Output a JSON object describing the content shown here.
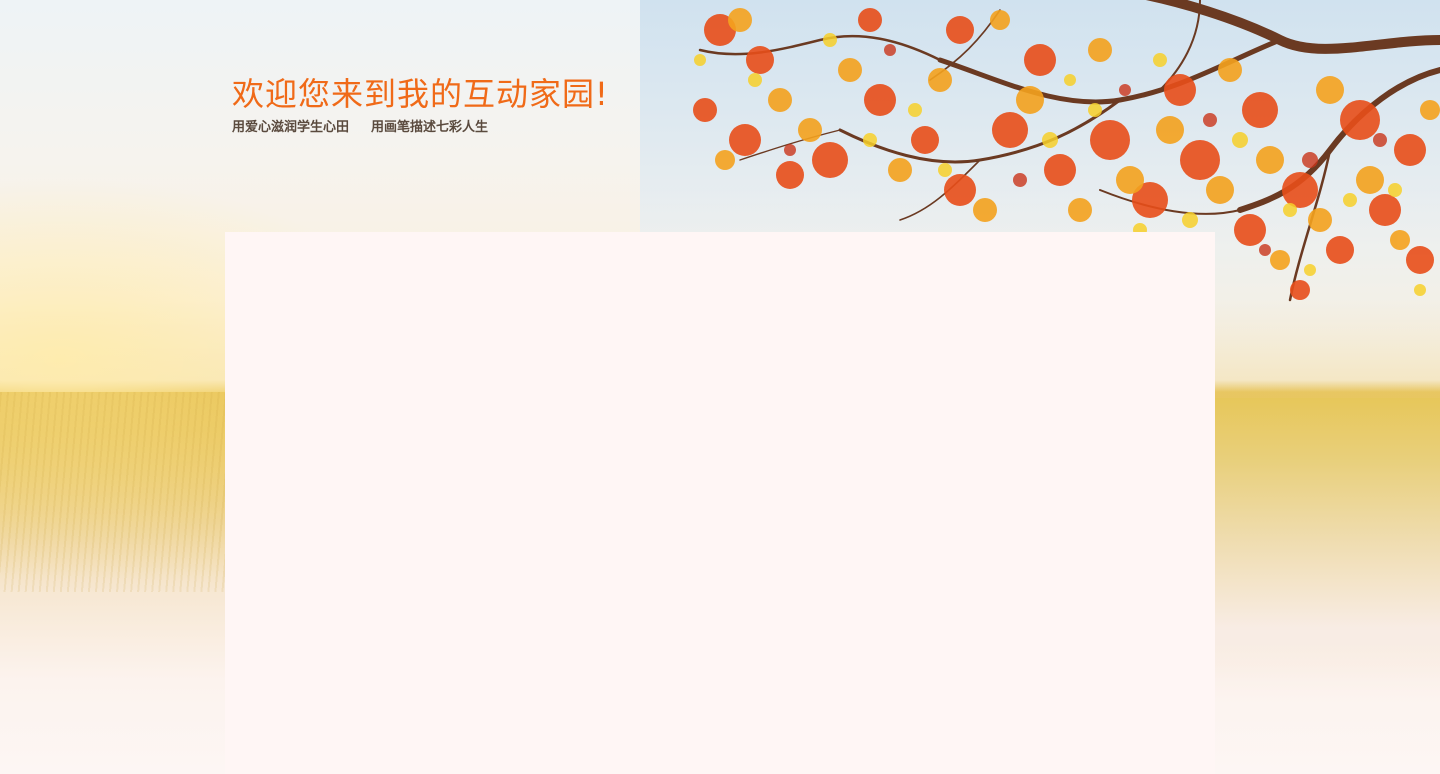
{
  "header": {
    "welcome_title": "欢迎您来到我的互动家园!",
    "slogan_left": "用爱心滋润学生心田",
    "slogan_right": "用画笔描述七彩人生"
  },
  "colors": {
    "title_color": "#f06a18",
    "slogan_color": "#5a4a3e",
    "panel_background": "#fff6f5"
  }
}
